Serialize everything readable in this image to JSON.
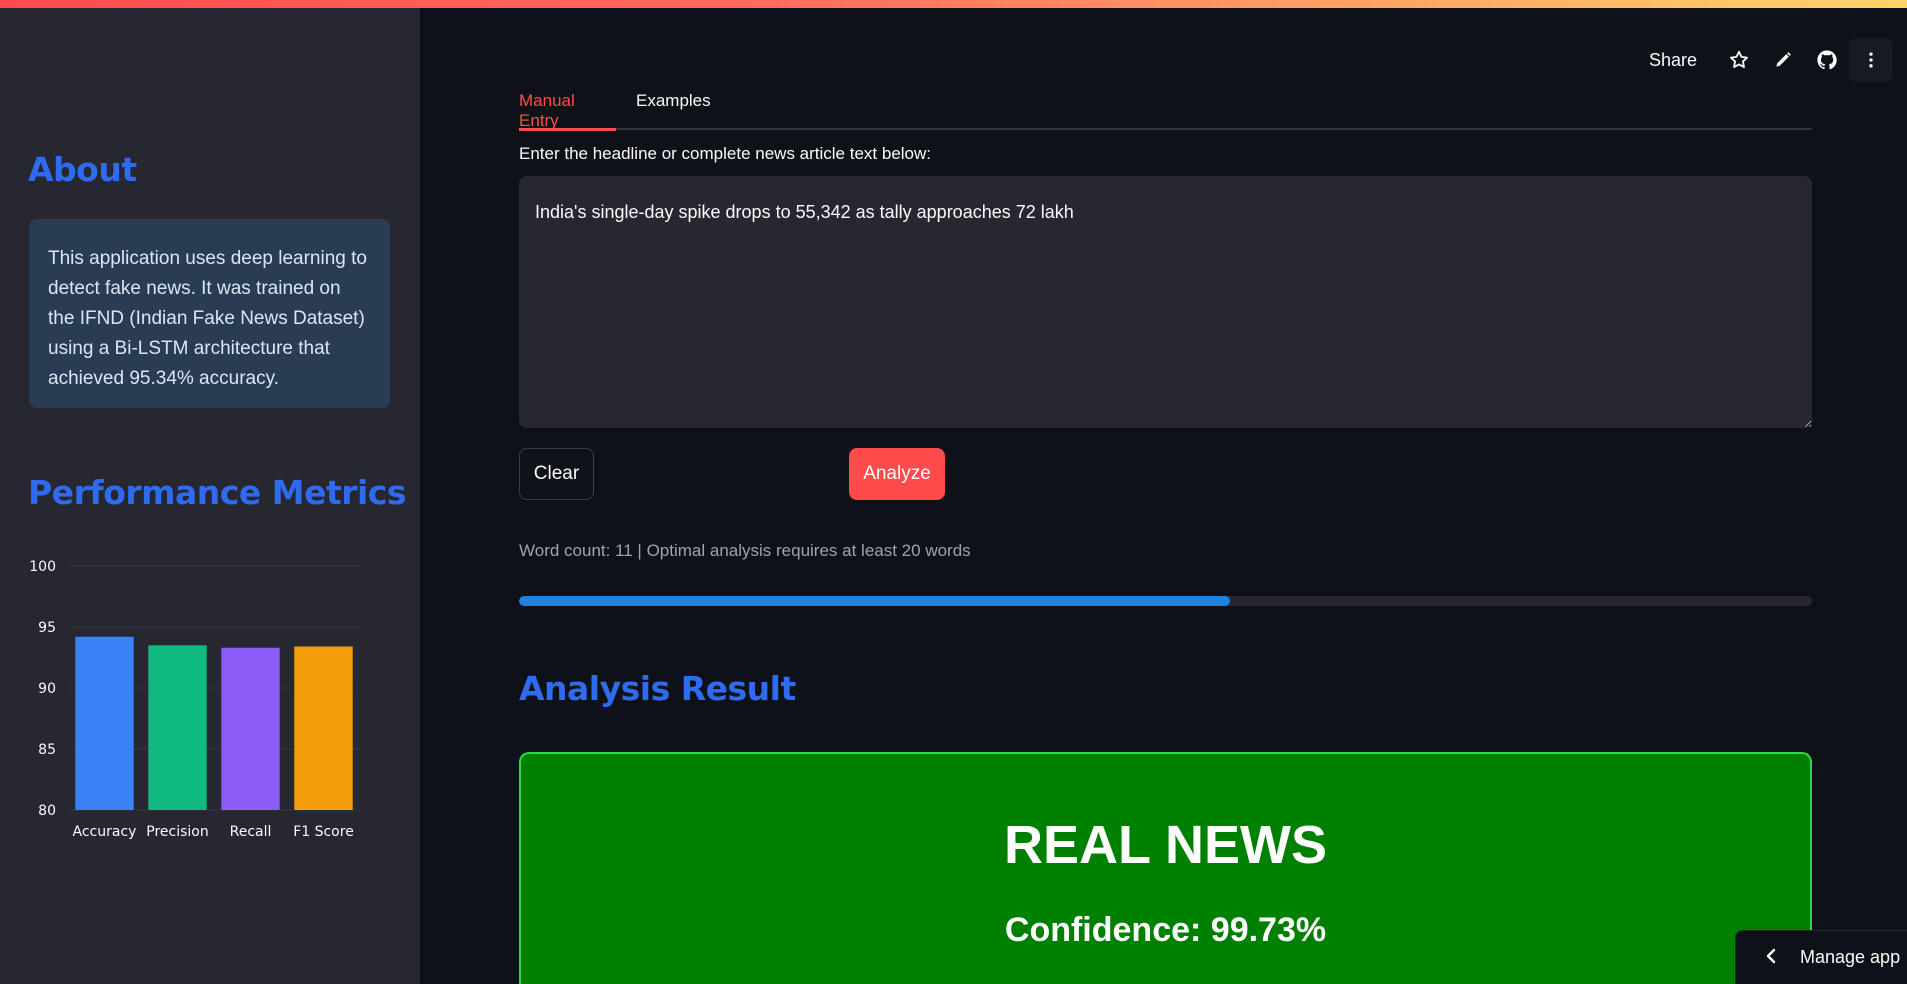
{
  "header": {
    "share_label": "Share",
    "icons": [
      "star-icon",
      "pencil-icon",
      "github-icon",
      "more-vertical-icon"
    ]
  },
  "sidebar": {
    "about_title": "About",
    "about_text": "This application uses deep learning to detect fake news. It was trained on the IFND (Indian Fake News Dataset) using a Bi-LSTM architecture that achieved 95.34% accuracy.",
    "metrics_title": "Performance Metrics"
  },
  "chart_data": {
    "type": "bar",
    "categories": [
      "Accuracy",
      "Precision",
      "Recall",
      "F1 Score"
    ],
    "values": [
      94.2,
      93.5,
      93.3,
      93.4
    ],
    "colors": [
      "#3b82f6",
      "#10b981",
      "#8b5cf6",
      "#f59e0b"
    ],
    "ylim": [
      80,
      100
    ],
    "yticks": [
      "80",
      "85",
      "90",
      "95",
      "100"
    ],
    "grid": true,
    "title": "",
    "xlabel": "",
    "ylabel": ""
  },
  "tabs": [
    {
      "label": "Manual Entry",
      "active": true
    },
    {
      "label": "Examples",
      "active": false
    }
  ],
  "input": {
    "label": "Enter the headline or complete news article text below:",
    "value": "India's single-day spike drops to 55,342 as tally approaches 72 lakh"
  },
  "buttons": {
    "clear_label": "Clear",
    "analyze_label": "Analyze"
  },
  "word_count_text": "Word count: 11 | Optimal analysis requires at least 20 words",
  "progress": 0.55,
  "result": {
    "title": "Analysis Result",
    "label": "REAL NEWS",
    "confidence_text": "Confidence: 99.73%",
    "color": "#008000"
  },
  "footer": {
    "manage_app_label": "Manage app"
  },
  "colors": {
    "accent": "#ff4b4b",
    "heading": "#2f6bf0",
    "progress": "#1c83e1"
  }
}
